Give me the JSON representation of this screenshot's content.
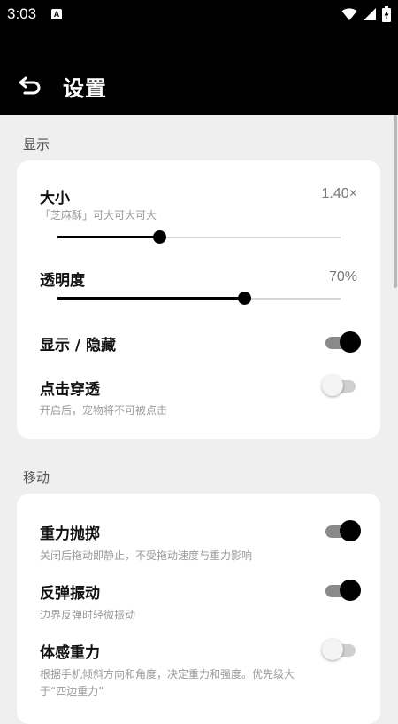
{
  "status_bar": {
    "time": "3:03",
    "notification_icon": "a-icon",
    "icons": [
      "wifi-icon",
      "signal-icon",
      "battery-charging-icon"
    ]
  },
  "app_bar": {
    "back_icon": "back-arrow-icon",
    "title": "设置"
  },
  "display_section": {
    "title": "显示",
    "size": {
      "label": "大小",
      "value": "1.40×",
      "description": "「芝麻酥」可大可大可大",
      "level": 0.36
    },
    "opacity": {
      "label": "透明度",
      "value": "70%",
      "level": 0.66
    },
    "show_hide": {
      "label": "显示 / 隐藏",
      "on": true
    },
    "click_through": {
      "label": "点击穿透",
      "description": "开启后，宠物将不可被点击",
      "on": false
    }
  },
  "move_section": {
    "title": "移动",
    "gravity_throw": {
      "label": "重力抛掷",
      "description": "关闭后拖动即静止，不受拖动速度与重力影响",
      "on": true
    },
    "bounce_vibration": {
      "label": "反弹振动",
      "description": "边界反弹时轻微振动",
      "on": true
    },
    "motion_gravity": {
      "label": "体感重力",
      "description_line1": "根据手机倾斜方向和角度，决定重力和强度。优先级大",
      "description_line2": "于“四边重力”",
      "on": false
    }
  },
  "colors": {
    "accent": "#000000",
    "background": "#efefef",
    "card": "#ffffff",
    "secondary_text": "#9a9a9a"
  }
}
